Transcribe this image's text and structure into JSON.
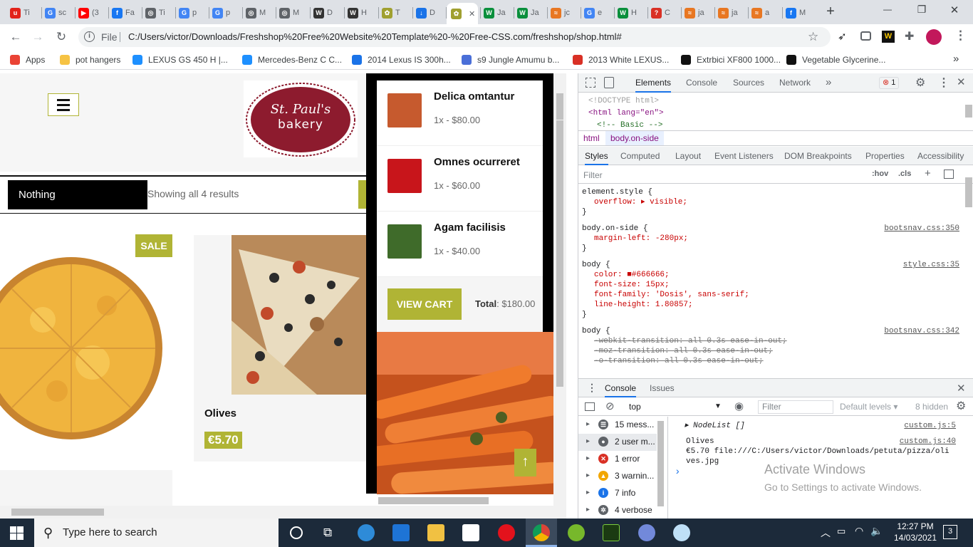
{
  "browser": {
    "tabs": [
      {
        "label": "Ti",
        "color": "#e2231a",
        "glyph": "u"
      },
      {
        "label": "sc",
        "color": "#4285f4",
        "glyph": "G"
      },
      {
        "label": "(3",
        "color": "#ff0000",
        "glyph": "▶"
      },
      {
        "label": "Fa",
        "color": "#1877f2",
        "glyph": "f"
      },
      {
        "label": "Ti",
        "color": "#5f6368",
        "glyph": "◎"
      },
      {
        "label": "p",
        "color": "#4285f4",
        "glyph": "G"
      },
      {
        "label": "p",
        "color": "#4285f4",
        "glyph": "G"
      },
      {
        "label": "M",
        "color": "#5f6368",
        "glyph": "◎"
      },
      {
        "label": "M",
        "color": "#5f6368",
        "glyph": "◎"
      },
      {
        "label": "D",
        "color": "#333333",
        "glyph": "W"
      },
      {
        "label": "H",
        "color": "#333333",
        "glyph": "W"
      },
      {
        "label": "T",
        "color": "#a0a030",
        "glyph": "✿"
      },
      {
        "label": "D",
        "color": "#1a73e8",
        "glyph": "↓"
      },
      {
        "label": "",
        "color": "#a0a030",
        "glyph": "✿",
        "active": true
      },
      {
        "label": "Ja",
        "color": "#0a8f3c",
        "glyph": "W"
      },
      {
        "label": "Ja",
        "color": "#0a8f3c",
        "glyph": "W"
      },
      {
        "label": "jc",
        "color": "#e87722",
        "glyph": "≈"
      },
      {
        "label": "e",
        "color": "#4285f4",
        "glyph": "G"
      },
      {
        "label": "H",
        "color": "#0a8f3c",
        "glyph": "W"
      },
      {
        "label": "C",
        "color": "#d93025",
        "glyph": "?"
      },
      {
        "label": "ja",
        "color": "#e87722",
        "glyph": "≈"
      },
      {
        "label": "ja",
        "color": "#e87722",
        "glyph": "≈"
      },
      {
        "label": "a",
        "color": "#e87722",
        "glyph": "≈"
      },
      {
        "label": "M",
        "color": "#1877f2",
        "glyph": "f"
      }
    ],
    "new_tab": "+",
    "window_controls": {
      "minimize": "—",
      "maximize": "❐",
      "close": "✕"
    },
    "url_prefix": "File",
    "url": "C:/Users/victor/Downloads/Freshshop%20Free%20Website%20Template%20-%20Free-CSS.com/freshshop/shop.html#",
    "bookmarks": [
      {
        "label": "Apps",
        "icon": "apps-icon",
        "color": "#ea4335"
      },
      {
        "label": "pot hangers",
        "icon": "folder-icon",
        "color": "#f6c344"
      },
      {
        "label": "LEXUS GS 450 H |...",
        "icon": "mp-icon",
        "color": "#1e90ff"
      },
      {
        "label": "Mercedes-Benz C C...",
        "icon": "mp-icon",
        "color": "#1e90ff"
      },
      {
        "label": "2014 Lexus IS 300h...",
        "icon": "autotrader-icon",
        "color": "#1a73e8"
      },
      {
        "label": "s9 Jungle Amumu b...",
        "icon": "mobafire-icon",
        "color": "#4a6fd8"
      },
      {
        "label": "2013 White LEXUS...",
        "icon": "car-icon",
        "color": "#d93025"
      },
      {
        "label": "Extrbici XF800 1000...",
        "icon": "amazon-icon",
        "color": "#111111"
      },
      {
        "label": "Vegetable Glycerine...",
        "icon": "amazon-icon",
        "color": "#111111"
      }
    ],
    "bookmarks_more": "»"
  },
  "shop": {
    "logo_line1": "St. Paul's",
    "logo_line2": "bakery",
    "sort_label": "Nothing",
    "results_text": "Showing all 4 results",
    "sale_badge": "SALE",
    "product_name": "Olives",
    "product_price": "€5.70",
    "cart": {
      "items": [
        {
          "name": "Delica omtantur",
          "qty_price": "1x - $80.00",
          "color": "#c65a2e"
        },
        {
          "name": "Omnes ocurreret",
          "qty_price": "1x - $60.00",
          "color": "#c8151b"
        },
        {
          "name": "Agam facilisis",
          "qty_price": "1x - $40.00",
          "color": "#3f6b2a"
        }
      ],
      "view_cart_label": "VIEW CART",
      "total_label": "Total",
      "total_value": ": $180.00"
    }
  },
  "devtools": {
    "tabs": [
      "Elements",
      "Console",
      "Sources",
      "Network"
    ],
    "more_tabs": "»",
    "error_count": "1",
    "dom_lines": [
      "<!DOCTYPE html>",
      "<html lang=\"en\">",
      "<!-- Basic -->"
    ],
    "breadcrumbs": [
      "html",
      "body.on-side"
    ],
    "style_tabs": [
      "Styles",
      "Computed",
      "Layout",
      "Event Listeners",
      "DOM Breakpoints",
      "Properties",
      "Accessibility"
    ],
    "filter_placeholder": "Filter",
    "hov": ":hov",
    "cls": ".cls",
    "rules": [
      {
        "selector": "element.style {",
        "source": "",
        "props": [
          "overflow: ▸ visible;"
        ]
      },
      {
        "selector": "body.on-side {",
        "source": "bootsnav.css:350",
        "props": [
          "margin-left: -280px;"
        ]
      },
      {
        "selector": "body {",
        "source": "style.css:35",
        "props": [
          "color: ■#666666;",
          "font-size: 15px;",
          "font-family: 'Dosis', sans-serif;",
          "line-height: 1.80857;"
        ]
      },
      {
        "selector": "body {",
        "source": "bootsnav.css:342",
        "props": [
          "-webkit-transition: all 0.3s ease-in-out;",
          "-moz-transition: all 0.3s ease-in-out;",
          "-o-transition: all 0.3s ease-in-out;"
        ]
      }
    ],
    "drawer_tabs": [
      "Console",
      "Issues"
    ],
    "context": "top",
    "console_filter": "Filter",
    "default_levels": "Default levels ▾",
    "hidden_count": "8 hidden",
    "sidebar": [
      {
        "label": "15 mess...",
        "icon": "list-icon",
        "color": "#5f6368"
      },
      {
        "label": "2 user m...",
        "icon": "user-icon",
        "color": "#5f6368"
      },
      {
        "label": "1 error",
        "icon": "error-icon",
        "color": "#d93025"
      },
      {
        "label": "3 warnin...",
        "icon": "warning-icon",
        "color": "#f2a600"
      },
      {
        "label": "7 info",
        "icon": "info-icon",
        "color": "#1a73e8"
      },
      {
        "label": "4 verbose",
        "icon": "bug-icon",
        "color": "#5f6368"
      }
    ],
    "log": [
      {
        "text": "▸ NodeList []",
        "source": "custom.js:5",
        "italic": true
      },
      {
        "text": "Olives",
        "source": "custom.js:40",
        "italic": false
      },
      {
        "text": "€5.70 file:///C:/Users/victor/Downloads/petuta/pizza/olives.jpg",
        "source": "",
        "italic": false
      }
    ],
    "prompt": "›",
    "watermark_title": "Activate Windows",
    "watermark_sub": "Go to Settings to activate Windows."
  },
  "taskbar": {
    "search_placeholder": "Type here to search",
    "time": "12:27 PM",
    "date": "14/03/2021",
    "notifications": "3"
  }
}
